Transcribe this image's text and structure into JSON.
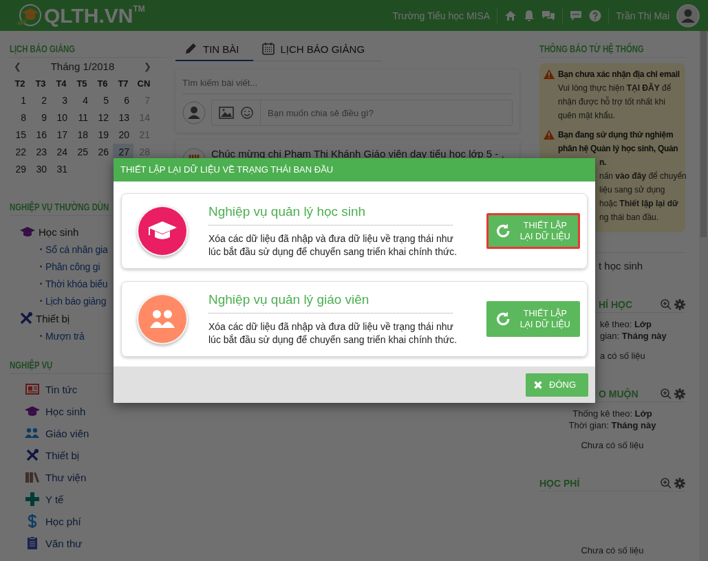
{
  "header": {
    "logo": "QLTH.VN$^{TM}$",
    "school": "Trường Tiểu học MISA",
    "user": "Trần Thị Mai"
  },
  "calendar": {
    "title": "LỊCH BÁO GIẢNG",
    "month": "Tháng 1/2018",
    "prev": "❮",
    "next": "❯",
    "weekdays": [
      "T2",
      "T3",
      "T4",
      "T5",
      "T6",
      "T7",
      "CN"
    ],
    "weeks": [
      [
        {
          "day": "1",
          "selected": false
        },
        {
          "day": "2",
          "selected": false
        },
        {
          "day": "3",
          "selected": false
        },
        {
          "day": "4",
          "selected": false
        },
        {
          "day": "5",
          "selected": false
        },
        {
          "day": "6",
          "selected": false
        },
        {
          "day": "7",
          "selected": false
        }
      ],
      [
        {
          "day": "8",
          "selected": false
        },
        {
          "day": "9",
          "selected": false
        },
        {
          "day": "10",
          "selected": false
        },
        {
          "day": "11",
          "selected": false
        },
        {
          "day": "12",
          "selected": false
        },
        {
          "day": "13",
          "selected": false
        },
        {
          "day": "14",
          "selected": false
        }
      ],
      [
        {
          "day": "15",
          "selected": false
        },
        {
          "day": "16",
          "selected": false
        },
        {
          "day": "17",
          "selected": false
        },
        {
          "day": "18",
          "selected": false
        },
        {
          "day": "19",
          "selected": false
        },
        {
          "day": "20",
          "selected": false
        },
        {
          "day": "21",
          "selected": false
        }
      ],
      [
        {
          "day": "22",
          "selected": false
        },
        {
          "day": "23",
          "selected": false
        },
        {
          "day": "24",
          "selected": false
        },
        {
          "day": "25",
          "selected": false
        },
        {
          "day": "26",
          "selected": false
        },
        {
          "day": "27",
          "selected": true
        },
        {
          "day": "28",
          "selected": false
        }
      ],
      [
        {
          "day": "29",
          "selected": false
        },
        {
          "day": "30",
          "selected": false
        },
        {
          "day": "31",
          "selected": false
        }
      ]
    ]
  },
  "frequent": {
    "title": "NGHIỆP VỤ THƯỜNG DÙN",
    "items": [
      {
        "label": "Học sinh",
        "children": [
          {
            "label": "Sổ cá nhân gia"
          },
          {
            "label": "Phân công gi"
          },
          {
            "label": "Thời khóa biểu"
          },
          {
            "label": "Lịch báo giảng"
          }
        ]
      },
      {
        "label": "Thiết bị",
        "children": [
          {
            "label": "Mượn trả"
          }
        ]
      }
    ]
  },
  "modules": {
    "title": "NGHIỆP VỤ",
    "items": [
      {
        "label": "Tin tức"
      },
      {
        "label": "Học sinh"
      },
      {
        "label": "Giáo viên"
      },
      {
        "label": "Thiết bị"
      },
      {
        "label": "Thư viện"
      },
      {
        "label": "Y tế"
      },
      {
        "label": "Học phí"
      },
      {
        "label": "Văn thư"
      }
    ]
  },
  "feed": {
    "tabs": [
      {
        "label": "TIN BÀI",
        "selected": true
      },
      {
        "label": "LỊCH BÁO GIẢNG",
        "selected": false
      }
    ],
    "search": {
      "placeholder": "Tìm kiếm bài viết..."
    },
    "composer": {
      "placeholder": "Bạn muốn chia sẻ điều gì?"
    },
    "post": {
      "text": "Chúc mừng chị Phạm Thị Khánh Giáo viên dạy tiểu học lớp 5 - ,"
    }
  },
  "notices": {
    "title": "THÔNG BÁO TỪ HỆ THỐNG",
    "items": [
      {
        "heading": "Bạn chưa xác nhận địa chỉ email",
        "body": "Vui lòng thực hiện **TẠI ĐÂY** để nhận được hỗ trợ tốt nhất khi quên mật khẩu."
      },
      {
        "heading": "Bạn đang sử dụng thử nghiệm phân hệ Quản lý học sinh, Quản",
        "right_of_dialog": {
          "heading": "n.",
          "lines": [
            "nấn **vào đây** để chuyển",
            "liệu sang sử dụng",
            "hoặc **Thiết lập lại dữ**",
            "ng thái ban đầu."
          ]
        }
      }
    ]
  },
  "selector": {
    "text": "t học sinh"
  },
  "widgets": [
    {
      "title": "HÍ HỌC",
      "title_behind_dialog": true,
      "body_behind_dialog": true,
      "lines": [
        {
          "label": "kê theo: ",
          "value": "Lớp"
        },
        {
          "label": "gian: ",
          "value": "Tháng này"
        }
      ],
      "empty": "a có số liệu"
    },
    {
      "title": "O MUỘN",
      "title_behind_dialog": true,
      "body_behind_dialog": false,
      "lines": [
        {
          "label": "Thống kê theo: ",
          "value": "Lớp"
        },
        {
          "label": "Thời gian: ",
          "value": "Tháng này"
        }
      ],
      "empty": "Chưa có số liệu"
    },
    {
      "title": "HỌC PHÍ",
      "empty": "Chưa có số liệu"
    }
  ],
  "dialog": {
    "title": "THIẾT LẬP LẠI DỮ LIỆU VỀ TRẠNG THÁI BAN ĐẦU",
    "cards": [
      {
        "title": "Nghiệp vụ quản lý học sinh",
        "color": "#e91e63",
        "text": "Xóa các dữ liệu đã nhập và đưa dữ liệu về trạng thái như lúc bắt đầu sử dụng để chuyển sang triển khai chính thức.",
        "button": "THIẾT LẬP LẠI DỮ LIỆU",
        "highlighted": true
      },
      {
        "title": "Nghiệp vụ quản lý giáo viên",
        "color": "#ff8a65",
        "text": "Xóa các dữ liệu đã nhập và đưa dữ liệu về trạng thái như lúc bắt đầu sử dụng để chuyển sang triển khai chính thức.",
        "button": "THIẾT LẬP LẠI DỮ LIỆU",
        "highlighted": false
      }
    ],
    "close": "ĐÓNG"
  }
}
